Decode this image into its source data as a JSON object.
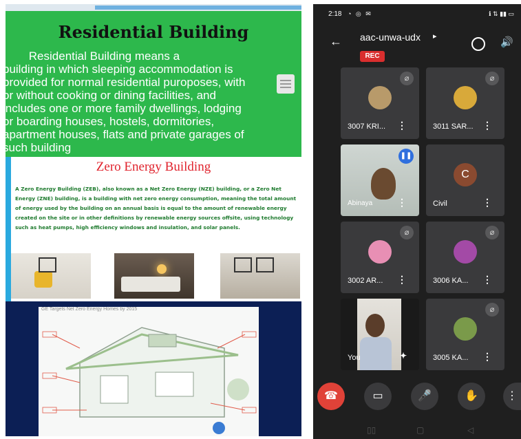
{
  "slide": {
    "residential_title": "Residential Building",
    "residential_text": "        Residential Building means a\nbuilding in which sleeping accommodation is\nprovided for normal residential puroposes, with\nor without cooking or dining facilities, and\nincludes one or more family dwellings, lodging\nor boarding houses, hostels, dormitories,\napartment houses, flats and private garages of\nsuch building",
    "zeb_title": "Zero Energy Building",
    "zeb_text": "A Zero Energy Building (ZEB), also known as a Net Zero Energy (NZE) building, or a Zero Net Energy (ZNE) building, is a building with net zero energy consumption, meaning the total amount of energy used by the building on an annual basis is equal to the amount of renewable energy created on the site or in other definitions by renewable energy sources offsite, using technology such as heat pumps, high efficiency windows and insulation, and solar panels.",
    "diagram_title": "GE Targets Net Zero Energy Homes by 2015"
  },
  "meet": {
    "status": {
      "time": "2:18",
      "indicators": "◔ ◎ ✉",
      "signal": "ℹ ⇅ ▮▮ ▭"
    },
    "meeting_code": "aac-unwa-udx",
    "rec_label": "REC",
    "participants": [
      {
        "name": "3007 KRI...",
        "muted": true
      },
      {
        "name": "3011 SAR...",
        "muted": true
      },
      {
        "name": "Abinaya",
        "muted": false,
        "speaking": true
      },
      {
        "name": "Civil",
        "muted": false,
        "initial": "C"
      },
      {
        "name": "3002 AR...",
        "muted": true
      },
      {
        "name": "3006 KA...",
        "muted": true
      },
      {
        "name": "You",
        "muted": false
      },
      {
        "name": "3005 KA...",
        "muted": true
      }
    ]
  }
}
